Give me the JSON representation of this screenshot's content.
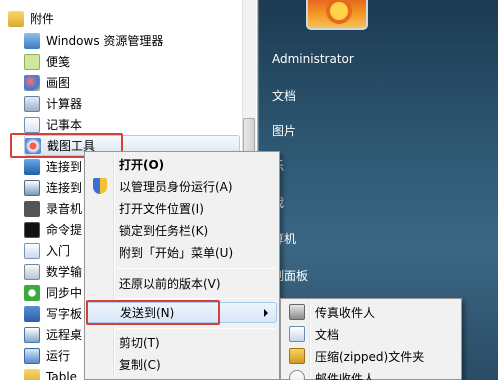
{
  "right_pane": {
    "items": [
      {
        "label": "Administrator"
      },
      {
        "label": "文档"
      },
      {
        "label": "图片"
      },
      {
        "label": "乐"
      },
      {
        "label": "戏"
      },
      {
        "label": "算机"
      },
      {
        "label": "制面板"
      }
    ]
  },
  "programs": {
    "folder_label": "附件",
    "items": [
      {
        "label": "Windows 资源管理器",
        "icon": "explorer-icon"
      },
      {
        "label": "便笺",
        "icon": "sticky-notes-icon"
      },
      {
        "label": "画图",
        "icon": "paint-icon"
      },
      {
        "label": "计算器",
        "icon": "calculator-icon"
      },
      {
        "label": "记事本",
        "icon": "notepad-icon"
      },
      {
        "label": "截图工具",
        "icon": "snipping-tool-icon"
      },
      {
        "label": "连接到",
        "icon": "remote-connect-icon"
      },
      {
        "label": "连接到",
        "icon": "projector-icon"
      },
      {
        "label": "录音机",
        "icon": "recorder-icon"
      },
      {
        "label": "命令提",
        "icon": "command-prompt-icon"
      },
      {
        "label": "入门",
        "icon": "getting-started-icon"
      },
      {
        "label": "数学输",
        "icon": "math-input-icon"
      },
      {
        "label": "同步中",
        "icon": "sync-center-icon"
      },
      {
        "label": "写字板",
        "icon": "wordpad-icon"
      },
      {
        "label": "远程桌",
        "icon": "remote-desktop-icon"
      },
      {
        "label": "运行",
        "icon": "run-icon"
      },
      {
        "label": "Table",
        "icon": "folder-icon"
      }
    ]
  },
  "context_menu": {
    "items": [
      {
        "label": "打开(O)"
      },
      {
        "label": "以管理员身份运行(A)"
      },
      {
        "label": "打开文件位置(I)"
      },
      {
        "label": "锁定到任务栏(K)"
      },
      {
        "label": "附到「开始」菜单(U)"
      },
      {
        "label": "还原以前的版本(V)"
      },
      {
        "label": "发送到(N)"
      },
      {
        "label": "剪切(T)"
      },
      {
        "label": "复制(C)"
      }
    ]
  },
  "send_to_menu": {
    "items": [
      {
        "label": "传真收件人",
        "icon": "fax-icon"
      },
      {
        "label": "文档",
        "icon": "documents-icon"
      },
      {
        "label": "压缩(zipped)文件夹",
        "icon": "zip-folder-icon"
      },
      {
        "label": "邮件收件人",
        "icon": "mail-icon"
      }
    ]
  },
  "colors": {
    "highlight_box": "#d6403b",
    "start_menu_dark": "#2c5570"
  }
}
